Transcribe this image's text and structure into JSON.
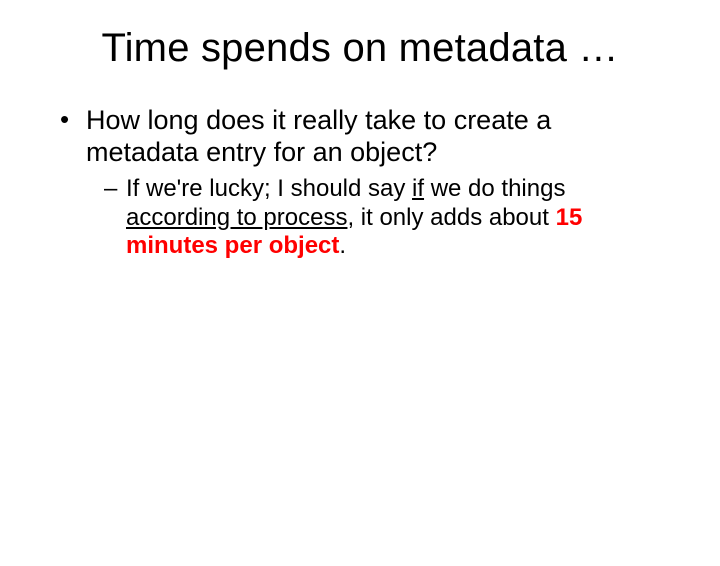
{
  "title": "Time spends on metadata …",
  "bullet1": "How long does it really take to create a metadata entry for an object?",
  "sub": {
    "p1": "If we're lucky; I should say ",
    "if": "if",
    "p2": " we do things ",
    "accProcess": "according to process",
    "p3": ", it only adds about ",
    "fifteen": "15 minutes per object",
    "p4": "."
  }
}
